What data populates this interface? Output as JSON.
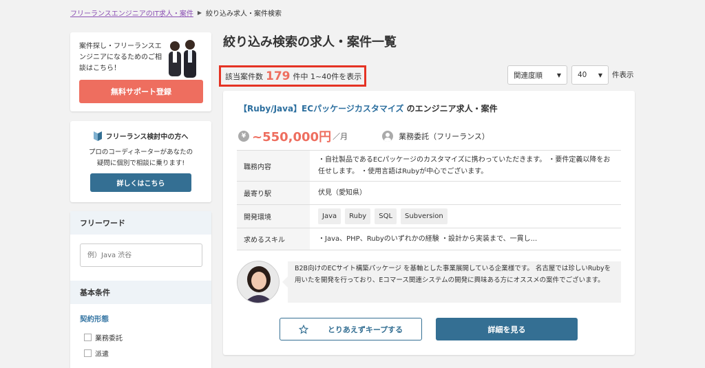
{
  "breadcrumb": {
    "home": "フリーランスエンジニアのIT求人・案件",
    "current": "絞り込み求人・案件検索"
  },
  "promo": {
    "text": "案件探し・フリーランスエンジニアになるためのご相談はこちら！",
    "button": "無料サポート登録"
  },
  "consult": {
    "title": "フリーランス検討中の方へ",
    "desc_line1": "プロのコーディネーターがあなたの",
    "desc_line2": "疑問に個別で相談に乗ります!",
    "button": "詳しくはこちら"
  },
  "filter": {
    "freeword_title": "フリーワード",
    "freeword_placeholder": "例）Java 渋谷",
    "basic_title": "基本条件",
    "contract_title": "契約形態",
    "options": [
      "業務委託",
      "派遣"
    ]
  },
  "main": {
    "title": "絞り込み検索の求人・案件一覧",
    "count_prefix": "該当案件数",
    "count": "179",
    "count_suffix": "件中 1~40件を表示",
    "sort": "関連度順",
    "per_page": "40",
    "per_page_label": "件表示"
  },
  "job": {
    "title_link": "【Ruby/Java】ECパッケージカスタマイズ",
    "title_suffix": "のエンジニア求人・案件",
    "yen_symbol": "¥",
    "salary": "~550,000円",
    "per_month": "／月",
    "contract": "業務委託（フリーランス）",
    "rows": [
      {
        "label": "職務内容",
        "value": "・自社製品であるECパッケージのカスタマイズに携わっていただきます。 ・要件定義以降をお任せします。 ・使用言語はRubyが中心でございます。"
      },
      {
        "label": "最寄り駅",
        "value": "伏見（愛知県）"
      },
      {
        "label": "開発環境",
        "value": ""
      },
      {
        "label": "求めるスキル",
        "value": "・Java、PHP、Rubyのいずれかの経験 ・設計から実装まで、一貫し..."
      }
    ],
    "tags": [
      "Java",
      "Ruby",
      "SQL",
      "Subversion"
    ],
    "comment": "B2B向けのECサイト構築パッケージ を基軸とした事業展開している企業様です。 名古屋では珍しいRubyを用いたを開発を行っており、Eコマース関連システムの開発に興味ある方にオススメの案件でございます。",
    "keep_button": "とりあえずキープする",
    "detail_button": "詳細を見る"
  },
  "colors": {
    "accent_red": "#ee6e5f",
    "primary_blue": "#346f93",
    "highlight_box": "#e53324"
  }
}
